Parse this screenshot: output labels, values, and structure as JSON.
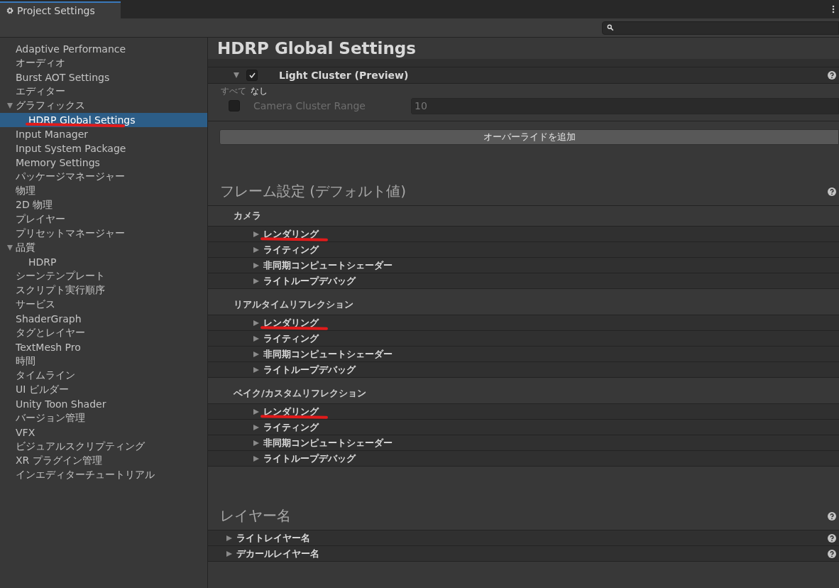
{
  "tab": {
    "title": "Project Settings"
  },
  "sidebar": {
    "items": [
      {
        "label": "Adaptive Performance",
        "selected": false
      },
      {
        "label": "オーディオ",
        "selected": false
      },
      {
        "label": "Burst AOT Settings",
        "selected": false
      },
      {
        "label": "エディター",
        "selected": false
      },
      {
        "label": "グラフィックス",
        "selected": false,
        "expanded": true,
        "children": [
          {
            "label": "HDRP Global Settings",
            "selected": true,
            "annotated": true
          }
        ]
      },
      {
        "label": "Input Manager",
        "selected": false
      },
      {
        "label": "Input System Package",
        "selected": false
      },
      {
        "label": "Memory Settings",
        "selected": false
      },
      {
        "label": "パッケージマネージャー",
        "selected": false
      },
      {
        "label": "物理",
        "selected": false
      },
      {
        "label": "2D 物理",
        "selected": false
      },
      {
        "label": "プレイヤー",
        "selected": false
      },
      {
        "label": "プリセットマネージャー",
        "selected": false
      },
      {
        "label": "品質",
        "selected": false,
        "expanded": true,
        "children": [
          {
            "label": "HDRP",
            "selected": false,
            "annotated": false
          }
        ]
      },
      {
        "label": "シーンテンプレート",
        "selected": false
      },
      {
        "label": "スクリプト実行順序",
        "selected": false
      },
      {
        "label": "サービス",
        "selected": false
      },
      {
        "label": "ShaderGraph",
        "selected": false
      },
      {
        "label": "タグとレイヤー",
        "selected": false
      },
      {
        "label": "TextMesh Pro",
        "selected": false
      },
      {
        "label": "時間",
        "selected": false
      },
      {
        "label": "タイムライン",
        "selected": false
      },
      {
        "label": "UI ビルダー",
        "selected": false
      },
      {
        "label": "Unity Toon Shader",
        "selected": false
      },
      {
        "label": "バージョン管理",
        "selected": false
      },
      {
        "label": "VFX",
        "selected": false
      },
      {
        "label": "ビジュアルスクリプティング",
        "selected": false
      },
      {
        "label": "XR プラグイン管理",
        "selected": false
      },
      {
        "label": "インエディターチュートリアル",
        "selected": false
      }
    ]
  },
  "page": {
    "title": "HDRP Global Settings"
  },
  "overrides": {
    "rows": [
      {
        "label": "Light Cluster (Preview)",
        "checked": true,
        "expanded": true
      }
    ],
    "toggle_all": "すべて",
    "toggle_none": "なし",
    "fields": [
      {
        "label": "Camera Cluster Range",
        "checked": false,
        "value": "10"
      }
    ],
    "add_button": "オーバーライドを追加"
  },
  "sections": [
    {
      "title": "フレーム設定 (デフォルト値)",
      "groups": [
        {
          "title": "カメラ",
          "items": [
            {
              "label": "レンダリング",
              "expanded": false,
              "annotated": true,
              "help": false
            },
            {
              "label": "ライティング",
              "expanded": false,
              "annotated": false,
              "help": false
            },
            {
              "label": "非同期コンピュートシェーダー",
              "expanded": false,
              "annotated": false,
              "help": false
            },
            {
              "label": "ライトループデバッグ",
              "expanded": false,
              "annotated": false,
              "help": false
            }
          ]
        },
        {
          "title": "リアルタイムリフレクション",
          "items": [
            {
              "label": "レンダリング",
              "expanded": false,
              "annotated": true,
              "help": false
            },
            {
              "label": "ライティング",
              "expanded": false,
              "annotated": false,
              "help": false
            },
            {
              "label": "非同期コンピュートシェーダー",
              "expanded": false,
              "annotated": false,
              "help": false
            },
            {
              "label": "ライトループデバッグ",
              "expanded": false,
              "annotated": false,
              "help": false
            }
          ]
        },
        {
          "title": "ベイク/カスタムリフレクション",
          "items": [
            {
              "label": "レンダリング",
              "expanded": false,
              "annotated": true,
              "help": false
            },
            {
              "label": "ライティング",
              "expanded": false,
              "annotated": false,
              "help": false
            },
            {
              "label": "非同期コンピュートシェーダー",
              "expanded": false,
              "annotated": false,
              "help": false
            },
            {
              "label": "ライトループデバッグ",
              "expanded": false,
              "annotated": false,
              "help": false
            }
          ]
        }
      ]
    },
    {
      "title": "レイヤー名",
      "groups": [
        {
          "items": [
            {
              "label": "ライトレイヤー名",
              "expanded": false,
              "annotated": false,
              "help": true
            },
            {
              "label": "デカールレイヤー名",
              "expanded": false,
              "annotated": false,
              "help": true
            }
          ]
        }
      ]
    }
  ]
}
